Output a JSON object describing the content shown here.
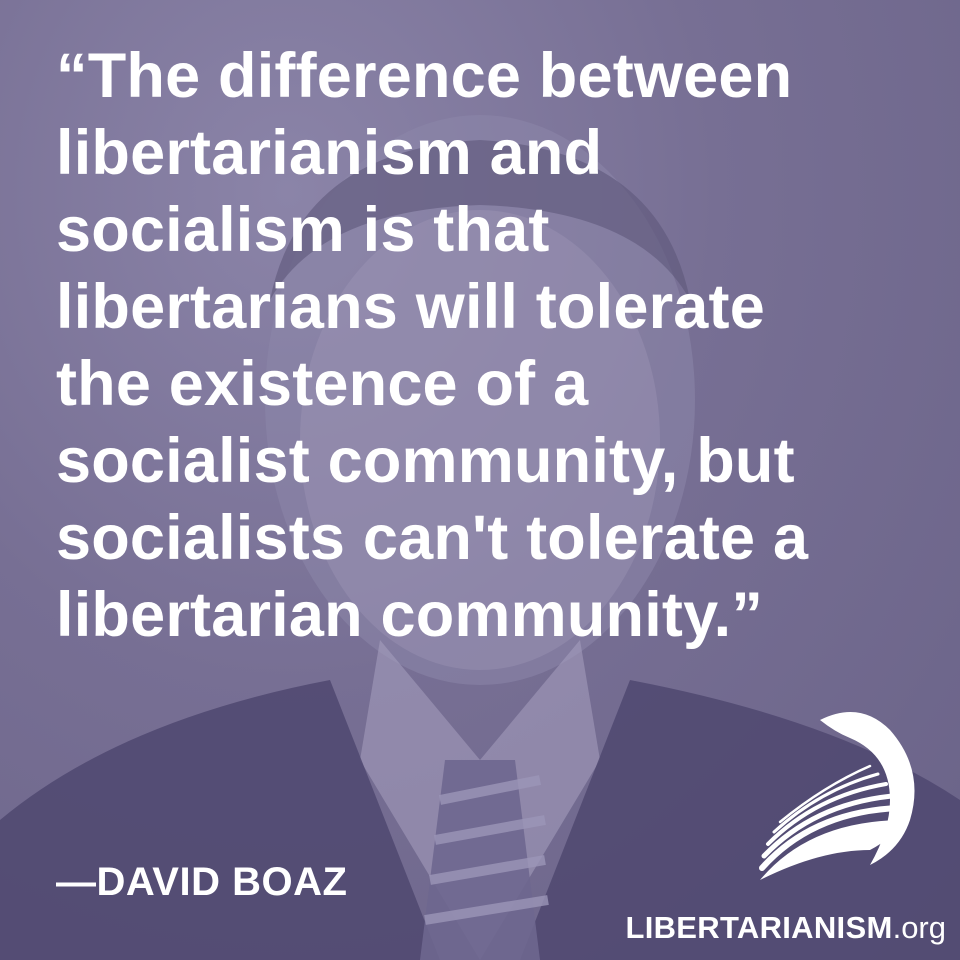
{
  "quote": {
    "lines": [
      "“The difference between",
      "libertarianism and",
      "socialism is that",
      "libertarians will tolerate",
      "the existence of a",
      "socialist community, but",
      "socialists can't tolerate a",
      "libertarian community.”"
    ]
  },
  "author": "—DAVID BOAZ",
  "brand": {
    "name": "LIBERTARIANISM",
    "tld": ".org",
    "logo_icon": "swan-wing-logo-icon"
  },
  "colors": {
    "overlay": "#7a7396",
    "text": "#ffffff"
  }
}
